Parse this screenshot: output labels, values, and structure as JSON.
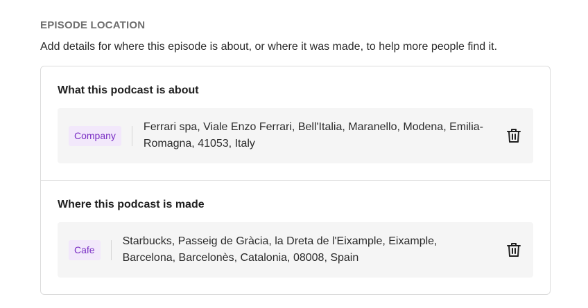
{
  "section": {
    "title": "EPISODE LOCATION",
    "description": "Add details for where this episode is about, or where it was made, to help more people find it."
  },
  "about": {
    "title": "What this podcast is about",
    "tag": "Company",
    "address": "Ferrari spa, Viale Enzo Ferrari, Bell'Italia, Maranello, Modena, Emilia-Romagna, 41053, Italy",
    "action_icon": "trash-icon"
  },
  "made": {
    "title": "Where this podcast is made",
    "tag": "Cafe",
    "address": "Starbucks, Passeig de Gràcia, la Dreta de l'Eixample, Eixample, Barcelona, Barcelonès, Catalonia, 08008, Spain",
    "action_icon": "trash-icon"
  },
  "colors": {
    "tag_bg": "#f2e8fb",
    "tag_text": "#7a2fc4",
    "row_bg": "#f5f5f5",
    "border": "#dcdcdc"
  }
}
